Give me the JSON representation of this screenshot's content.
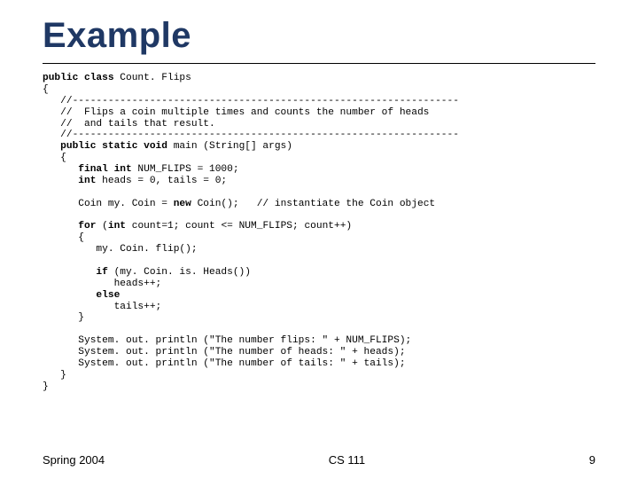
{
  "slide": {
    "title": "Example",
    "footer_left": "Spring 2004",
    "footer_center": "CS 111",
    "footer_right": "9"
  },
  "code": {
    "l01a": "public class",
    "l01b": " Count. Flips",
    "l02": "{",
    "l03": "   //-----------------------------------------------------------------",
    "l04": "   //  Flips a coin multiple times and counts the number of heads",
    "l05": "   //  and tails that result.",
    "l06": "   //-----------------------------------------------------------------",
    "l07a": "   public static void",
    "l07b": " main (String[] args)",
    "l08": "   {",
    "l09a": "      final int",
    "l09b": " NUM_FLIPS = 1000;",
    "l10a": "      int",
    "l10b": " heads = 0, tails = 0;",
    "l11": "",
    "l12a": "      Coin my. Coin = ",
    "l12b": "new",
    "l12c": " Coin();   // instantiate the Coin object",
    "l13": "",
    "l14a": "      for",
    "l14b": " (",
    "l14c": "int",
    "l14d": " count=1; count <= NUM_FLIPS; count++)",
    "l15": "      {",
    "l16": "         my. Coin. flip();",
    "l17": "",
    "l18a": "         if",
    "l18b": " (my. Coin. is. Heads())",
    "l19": "            heads++;",
    "l20a": "         else",
    "l20b": "",
    "l21": "            tails++;",
    "l22": "      }",
    "l23": "",
    "l24": "      System. out. println (\"The number flips: \" + NUM_FLIPS);",
    "l25": "      System. out. println (\"The number of heads: \" + heads);",
    "l26": "      System. out. println (\"The number of tails: \" + tails);",
    "l27": "   }",
    "l28": "}"
  }
}
